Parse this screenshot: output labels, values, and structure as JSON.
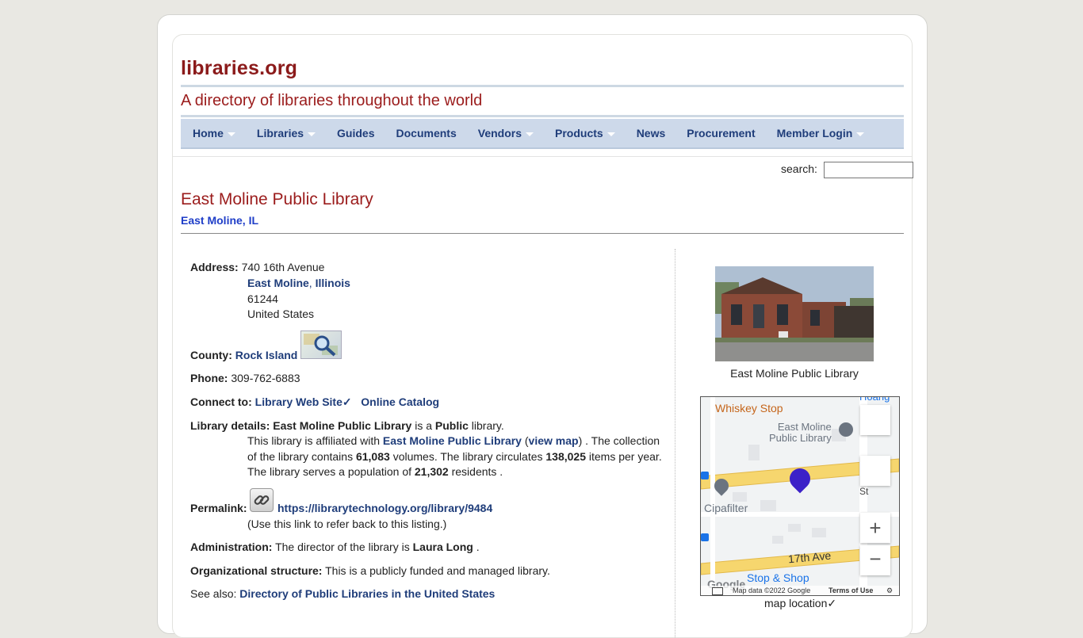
{
  "site": {
    "title": "libraries.org",
    "tagline": "A directory of libraries throughout the world"
  },
  "nav": {
    "items": [
      {
        "label": "Home",
        "has_menu": true
      },
      {
        "label": "Libraries",
        "has_menu": true
      },
      {
        "label": "Guides",
        "has_menu": false
      },
      {
        "label": "Documents",
        "has_menu": false
      },
      {
        "label": "Vendors",
        "has_menu": true
      },
      {
        "label": "Products",
        "has_menu": true
      },
      {
        "label": "News",
        "has_menu": false
      },
      {
        "label": "Procurement",
        "has_menu": false
      },
      {
        "label": "Member Login",
        "has_menu": true
      }
    ]
  },
  "search": {
    "label": "search:",
    "value": ""
  },
  "library": {
    "name": "East Moline Public Library",
    "location": "East Moline, IL"
  },
  "details": {
    "address_label": "Address:",
    "street": "740 16th Avenue",
    "city_link": "East Moline",
    "state_link": "Illinois",
    "zip": "61244",
    "country": "United States",
    "county_label": "County:",
    "county": "Rock Island",
    "phone_label": "Phone:",
    "phone": "309-762-6883",
    "connect_label": "Connect to:",
    "website_link": "Library Web Site✓",
    "catalog_link": "Online Catalog",
    "details_label": "Library details:",
    "details_name": "East Moline Public Library",
    "details_is": "is a",
    "details_type": "Public",
    "details_library": "library.",
    "affiliated_text": "This library is affiliated with",
    "affiliated_link": "East Moline Public Library",
    "view_map": "view map",
    "collection_text": ". The collection of the library contains",
    "volumes": "61,083",
    "volumes_text": "volumes. The library circulates",
    "circulation": "138,025",
    "circulation_text": "items per year. The library serves a population of",
    "population": "21,302",
    "population_text": "residents .",
    "permalink_label": "Permalink:",
    "permalink_url": "https://librarytechnology.org/library/9484",
    "permalink_note": "(Use this link to refer back to this listing.)",
    "admin_label": "Administration:",
    "admin_text": "The director of the library is",
    "director": "Laura Long",
    "admin_end": ".",
    "org_label": "Organizational structure:",
    "org_text": "This is a publicly funded and managed library.",
    "see_also_label": "See also:",
    "see_also_link": "Directory of Public Libraries in the United States"
  },
  "photo": {
    "caption": "East Moline Public Library"
  },
  "map": {
    "caption": "map location✓",
    "labels": {
      "whiskey": "Whiskey Stop",
      "library_line1": "East Moline",
      "library_line2": "Public Library",
      "cipafilter": "Cipafilter",
      "avenue": "17th Ave",
      "stop_shop": "Stop & Shop",
      "street": "St",
      "hoang": "Hoang",
      "map_data": "Map data ©2022 Google",
      "terms": "Terms of Use",
      "google": "Google"
    },
    "colors": {
      "road": "#f6d66e",
      "pin": "#3c21c8",
      "label_orange": "#c5651a",
      "poi_gray": "#6b7480",
      "poi_blue": "#1a73e8"
    }
  }
}
